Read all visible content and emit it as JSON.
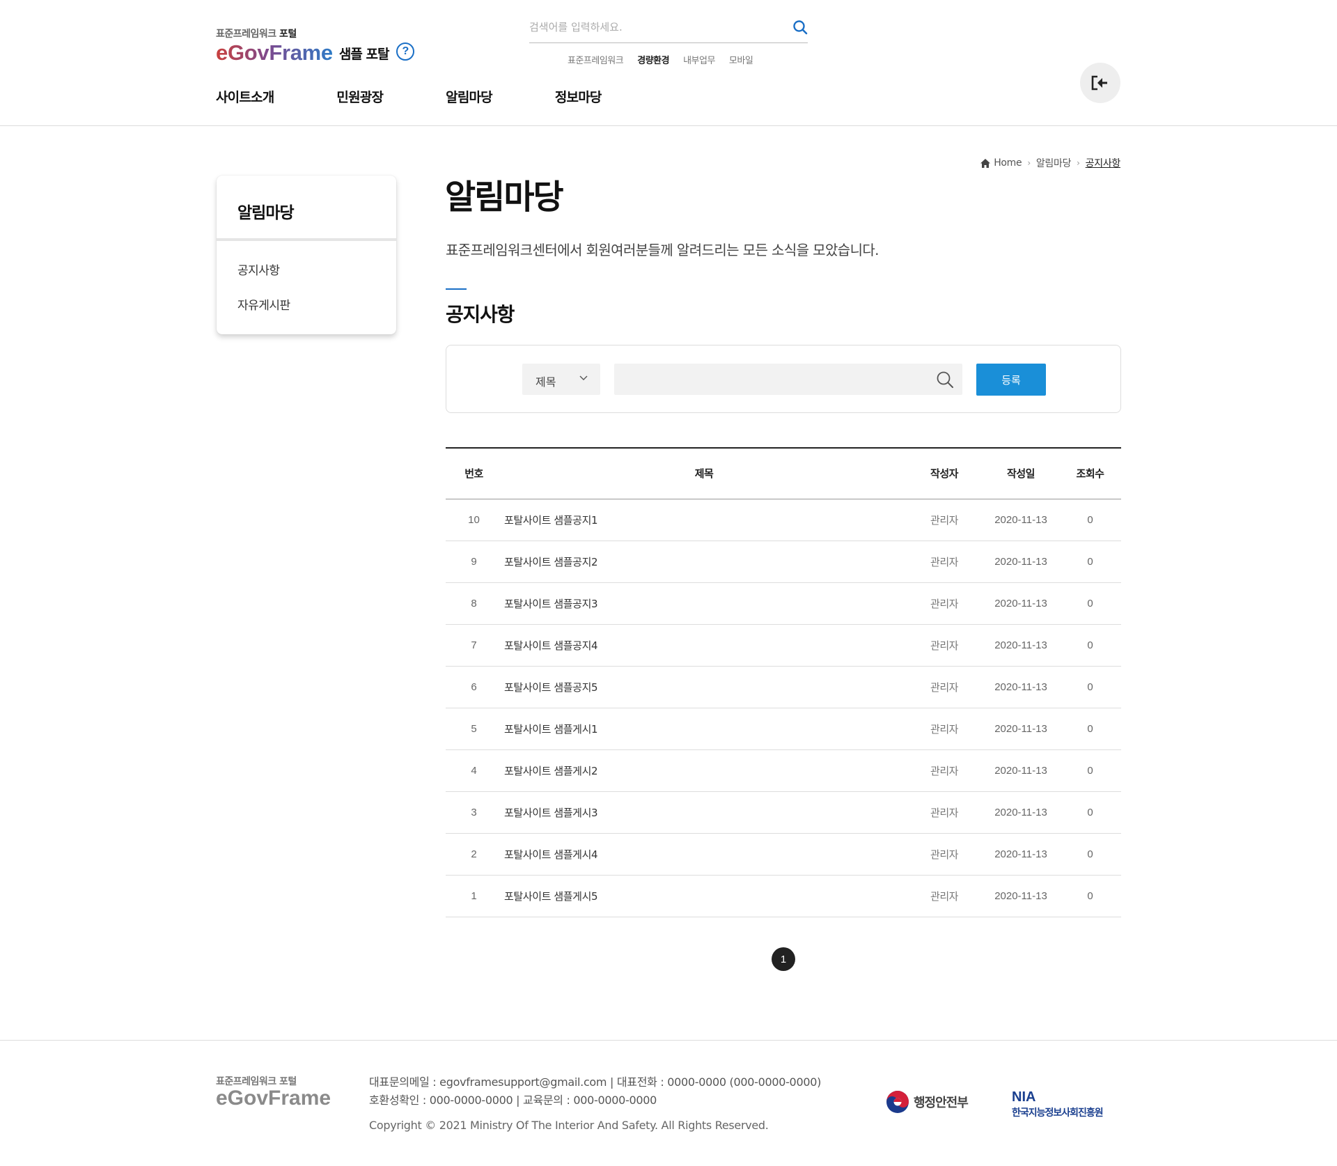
{
  "header": {
    "logo_small_prefix": "표준프레임워크 ",
    "logo_small_bold": "포털",
    "logo_main": "eGovFrame",
    "logo_sample": "샘플 포탈",
    "help_icon_glyph": "?",
    "search_placeholder": "검색어를 입력하세요.",
    "quick_links": [
      "표준프레임워크",
      "경량환경",
      "내부업무",
      "모바일"
    ],
    "quick_links_active": "경량환경",
    "gnb": [
      "사이트소개",
      "민원광장",
      "알림마당",
      "정보마당"
    ]
  },
  "lnb": {
    "title": "알림마당",
    "items": [
      "공지사항",
      "자유게시판"
    ]
  },
  "breadcrumb": {
    "home": "Home",
    "level1": "알림마당",
    "current": "공지사항"
  },
  "page": {
    "title": "알림마당",
    "description": "표준프레임워크센터에서 회원여러분들께 알려드리는 모든 소식을 모았습니다.",
    "section_title": "공지사항"
  },
  "search": {
    "select_value": "제목",
    "keyword_value": "",
    "register_label": "등록"
  },
  "board": {
    "headers": [
      "번호",
      "제목",
      "작성자",
      "작성일",
      "조회수"
    ],
    "rows": [
      {
        "no": "10",
        "subject": "포탈사이트 샘플공지1",
        "writer": "관리자",
        "date": "2020-11-13",
        "views": "0"
      },
      {
        "no": "9",
        "subject": "포탈사이트 샘플공지2",
        "writer": "관리자",
        "date": "2020-11-13",
        "views": "0"
      },
      {
        "no": "8",
        "subject": "포탈사이트 샘플공지3",
        "writer": "관리자",
        "date": "2020-11-13",
        "views": "0"
      },
      {
        "no": "7",
        "subject": "포탈사이트 샘플공지4",
        "writer": "관리자",
        "date": "2020-11-13",
        "views": "0"
      },
      {
        "no": "6",
        "subject": "포탈사이트 샘플공지5",
        "writer": "관리자",
        "date": "2020-11-13",
        "views": "0"
      },
      {
        "no": "5",
        "subject": "포탈사이트 샘플게시1",
        "writer": "관리자",
        "date": "2020-11-13",
        "views": "0"
      },
      {
        "no": "4",
        "subject": "포탈사이트 샘플게시2",
        "writer": "관리자",
        "date": "2020-11-13",
        "views": "0"
      },
      {
        "no": "3",
        "subject": "포탈사이트 샘플게시3",
        "writer": "관리자",
        "date": "2020-11-13",
        "views": "0"
      },
      {
        "no": "2",
        "subject": "포탈사이트 샘플게시4",
        "writer": "관리자",
        "date": "2020-11-13",
        "views": "0"
      },
      {
        "no": "1",
        "subject": "포탈사이트 샘플게시5",
        "writer": "관리자",
        "date": "2020-11-13",
        "views": "0"
      }
    ]
  },
  "pagination": {
    "current_page": "1"
  },
  "footer": {
    "logo_small": "표준프레임워크 포털",
    "logo_big": "eGovFrame",
    "info_line1": "대표문의메일 : egovframesupport@gmail.com | 대표전화 : 0000-0000 (000-0000-0000)",
    "info_line2": "호환성확인 : 000-0000-0000 | 교육문의 : 000-0000-0000",
    "copyright": "Copyright © 2021 Ministry Of The Interior And Safety. All Rights Reserved.",
    "mois_label": "행정안전부",
    "nia_abbr": "NIA",
    "nia_full": "한국지능정보사회진흥원"
  },
  "colors": {
    "accent": "#1a8fd8",
    "link_blue": "#1a6fc6",
    "nia_blue": "#1a3f8f"
  },
  "icons": [
    "search-icon",
    "help-icon",
    "logout-icon",
    "home-icon",
    "chevron-down-icon",
    "mois-emblem-icon"
  ]
}
